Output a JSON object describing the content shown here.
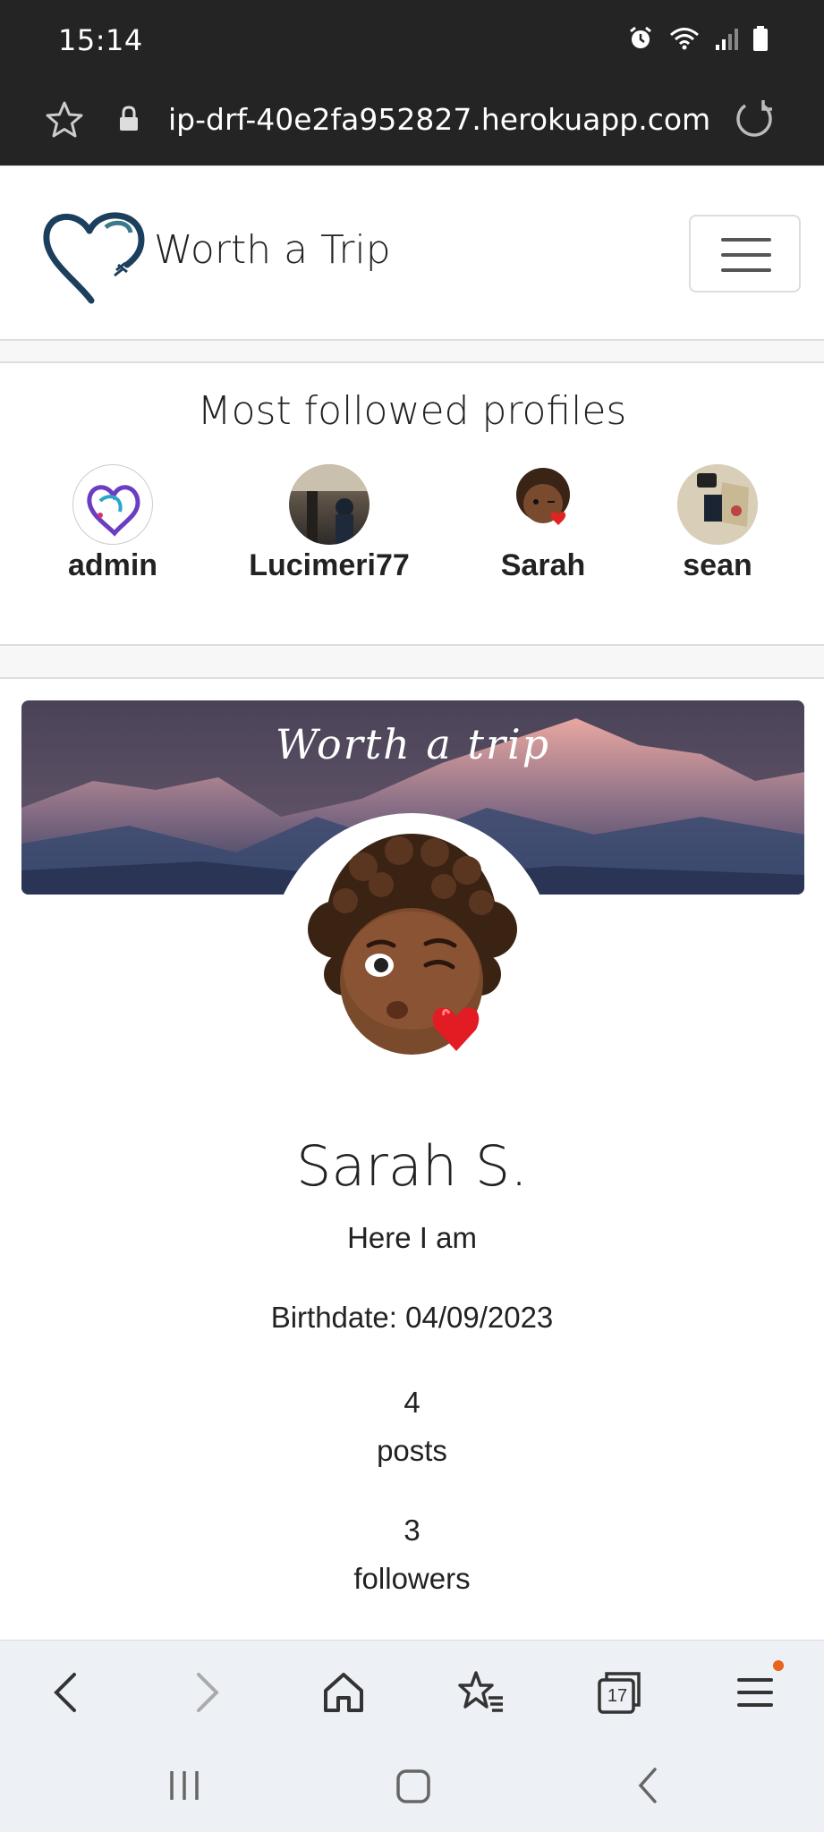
{
  "status_bar": {
    "time": "15:14"
  },
  "browser": {
    "url": "ip-drf-40e2fa952827.herokuapp.com",
    "tab_count": "17"
  },
  "navbar": {
    "brand": "Worth a Trip"
  },
  "most_followed": {
    "title": "Most followed profiles",
    "profiles": [
      {
        "name": "admin"
      },
      {
        "name": "Lucimeri77"
      },
      {
        "name": "Sarah"
      },
      {
        "name": "sean"
      }
    ]
  },
  "profile": {
    "banner_text": "Worth a trip",
    "name": "Sarah S.",
    "bio": "Here I am",
    "birthdate": "Birthdate: 04/09/2023",
    "stats": [
      {
        "value": "4",
        "label": "posts"
      },
      {
        "value": "3",
        "label": "followers"
      }
    ]
  },
  "colors": {
    "brand_heart": "#1c3f5e",
    "menu_badge": "#e8631c"
  }
}
